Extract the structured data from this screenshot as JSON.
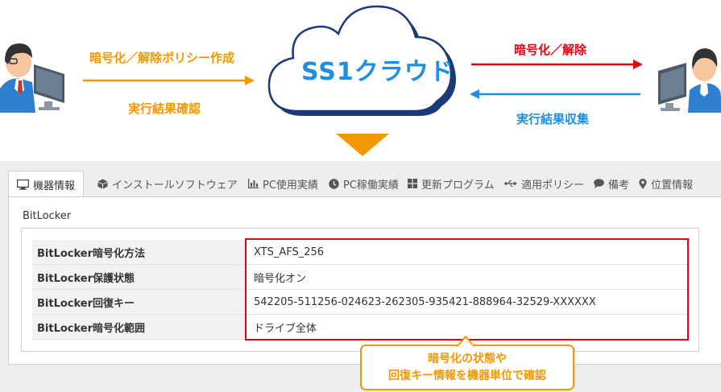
{
  "diagram": {
    "cloud_logo": "SS1クラウド",
    "left_top_label": "暗号化／解除ポリシー作成",
    "left_bottom_label": "実行結果確認",
    "right_top_label": "暗号化／解除",
    "right_bottom_label": "実行結果収集",
    "colors": {
      "orange": "#f39800",
      "red": "#e60012",
      "blue": "#1e8fe1"
    }
  },
  "tabs": [
    {
      "label": "機器情報",
      "icon": "monitor-icon",
      "active": true
    },
    {
      "label": "インストールソフトウェア",
      "icon": "box-icon",
      "active": false
    },
    {
      "label": "PC使用実績",
      "icon": "bar-chart-icon",
      "active": false
    },
    {
      "label": "PC稼働実績",
      "icon": "clock-icon",
      "active": false
    },
    {
      "label": "更新プログラム",
      "icon": "windows-icon",
      "active": false
    },
    {
      "label": "適用ポリシー",
      "icon": "usb-icon",
      "active": false
    },
    {
      "label": "備考",
      "icon": "comment-icon",
      "active": false
    },
    {
      "label": "位置情報",
      "icon": "map-pin-icon",
      "active": false
    }
  ],
  "section": {
    "title": "BitLocker",
    "rows": [
      {
        "key": "BitLocker暗号化方法",
        "value": "XTS_AFS_256"
      },
      {
        "key": "BitLocker保護状態",
        "value": "暗号化オン"
      },
      {
        "key": "BitLocker回復キー",
        "value": "542205-511256-024623-262305-935421-888964-32529-XXXXXX"
      },
      {
        "key": "BitLocker暗号化範囲",
        "value": "ドライブ全体"
      }
    ]
  },
  "callout": {
    "line1": "暗号化の状態や",
    "line2": "回復キー情報を機器単位で確認"
  }
}
